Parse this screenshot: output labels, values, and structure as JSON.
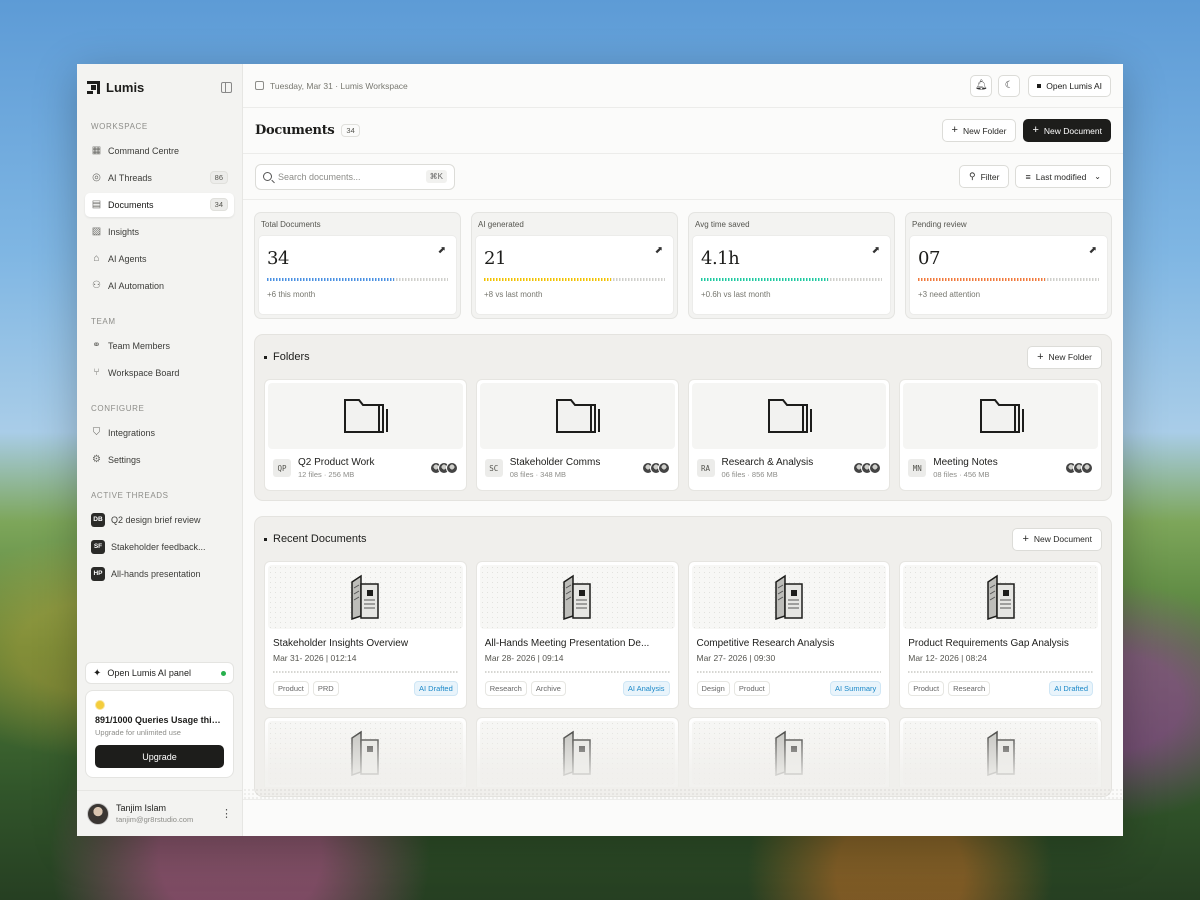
{
  "brand": {
    "name": "Lumis"
  },
  "sidebar": {
    "workspace_title": "WORKSPACE",
    "workspace": [
      {
        "label": "Command Centre",
        "icon": "grid-icon",
        "count": ""
      },
      {
        "label": "AI Threads",
        "icon": "thread-icon",
        "count": "86"
      },
      {
        "label": "Documents",
        "icon": "document-icon",
        "count": "34"
      },
      {
        "label": "Insights",
        "icon": "chart-icon",
        "count": ""
      },
      {
        "label": "AI Agents",
        "icon": "bot-icon",
        "count": ""
      },
      {
        "label": "AI Automation",
        "icon": "automation-icon",
        "count": ""
      }
    ],
    "team_title": "TEAM",
    "team": [
      {
        "label": "Team Members",
        "icon": "users-icon"
      },
      {
        "label": "Workspace Board",
        "icon": "branch-icon"
      }
    ],
    "configure_title": "CONFIGURE",
    "configure": [
      {
        "label": "Integrations",
        "icon": "shield-icon"
      },
      {
        "label": "Settings",
        "icon": "gear-icon"
      }
    ],
    "threads_title": "ACTIVE THREADS",
    "threads": [
      {
        "badge": "DB",
        "label": "Q2 design brief review"
      },
      {
        "badge": "SF",
        "label": "Stakeholder feedback..."
      },
      {
        "badge": "HP",
        "label": "All-hands presentation"
      }
    ],
    "ai_panel_label": "Open Lumis AI panel",
    "usage": {
      "title": "891/1000 Queries Usage this...",
      "subtitle": "Upgrade for unlimited use",
      "button": "Upgrade"
    },
    "user": {
      "name": "Tanjim Islam",
      "email": "tanjim@gr8rstudio.com"
    }
  },
  "topbar": {
    "date": "Tuesday, Mar 31 · Lumis Workspace",
    "open_ai": "Open Lumis AI"
  },
  "header": {
    "title": "Documents",
    "count": "34",
    "new_folder": "New Folder",
    "new_document": "New Document"
  },
  "toolbar": {
    "search_placeholder": "Search documents...",
    "shortcut": "⌘K",
    "filter": "Filter",
    "sort": "Last modified"
  },
  "stats": [
    {
      "label": "Total Documents",
      "value": "34",
      "note": "+6 this month",
      "color": "#4a90e2",
      "fill": 0.7
    },
    {
      "label": "AI generated",
      "value": "21",
      "note": "+8 vs last month",
      "color": "#f2c200",
      "fill": 0.7
    },
    {
      "label": "Avg time saved",
      "value": "4.1h",
      "note": "+0.6h vs last month",
      "color": "#1ec9a0",
      "fill": 0.7
    },
    {
      "label": "Pending review",
      "value": "07",
      "note": "+3 need attention",
      "color": "#f07a3c",
      "fill": 0.7
    }
  ],
  "folders": {
    "title": "Folders",
    "new_button": "New Folder",
    "items": [
      {
        "badge": "QP",
        "name": "Q2 Product Work",
        "info": "12 files · 256 MB"
      },
      {
        "badge": "SC",
        "name": "Stakeholder Comms",
        "info": "08 files · 348 MB"
      },
      {
        "badge": "RA",
        "name": "Research & Analysis",
        "info": "06 files · 856 MB"
      },
      {
        "badge": "MN",
        "name": "Meeting Notes",
        "info": "08 files · 456 MB"
      }
    ]
  },
  "recent": {
    "title": "Recent Documents",
    "new_button": "New Document",
    "items": [
      {
        "title": "Stakeholder Insights Overview",
        "date": "Mar 31- 2026 | 012:14",
        "tags": [
          "Product",
          "PRD"
        ],
        "ai": "AI Drafted"
      },
      {
        "title": "All-Hands Meeting Presentation De...",
        "date": "Mar 28- 2026 | 09:14",
        "tags": [
          "Research",
          "Archive"
        ],
        "ai": "AI Analysis"
      },
      {
        "title": "Competitive Research Analysis",
        "date": "Mar 27- 2026 | 09:30",
        "tags": [
          "Design",
          "Product"
        ],
        "ai": "AI Summary"
      },
      {
        "title": "Product Requirements Gap Analysis",
        "date": "Mar 12- 2026 | 08:24",
        "tags": [
          "Product",
          "Research"
        ],
        "ai": "AI Drafted"
      }
    ]
  }
}
